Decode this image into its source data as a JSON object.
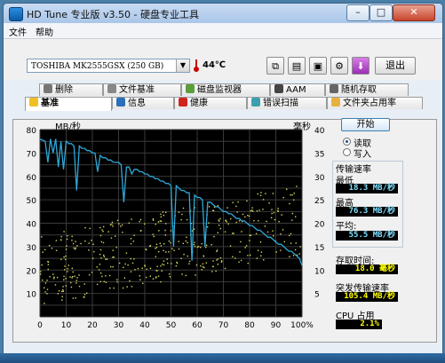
{
  "window": {
    "title": "HD Tune 专业版 v3.50 - 硬盘专业工具",
    "controls": {
      "minimize": "–",
      "maximize": "□",
      "close": "✕"
    }
  },
  "menu": {
    "items": [
      "文件",
      "帮助"
    ]
  },
  "toolbar": {
    "drive": "TOSHIBA MK2555GSX (250 GB)",
    "temperature": "44℃",
    "exit_label": "退出",
    "icons": [
      "copy-info-icon",
      "copy-screen-icon",
      "save-icon",
      "options-icon",
      "download-icon"
    ]
  },
  "tabs": {
    "row1": [
      "删除",
      "文件基准",
      "磁盘监视器",
      "AAM",
      "随机存取"
    ],
    "row2": [
      "基准",
      "信息",
      "健康",
      "错误扫描",
      "文件夹占用率"
    ],
    "active": "基准"
  },
  "benchmark": {
    "start_label": "开始",
    "mode_options": [
      "读取",
      "写入"
    ],
    "selected_mode": "读取",
    "transfer_rate_label": "传输速率",
    "min_label": "最低",
    "min_value": "18.3 MB/秒",
    "max_label": "最高",
    "max_value": "76.3 MB/秒",
    "avg_label": "平均:",
    "avg_value": "55.5 MB/秒",
    "access_time_label": "存取时间:",
    "access_time_value": "18.0 毫秒",
    "burst_label": "突发传输速率",
    "burst_value": "105.4 MB/秒",
    "cpu_label": "CPU 占用",
    "cpu_value": "2.1%"
  },
  "chart_data": {
    "type": "line",
    "y_left_unit": "MB/秒",
    "y_right_unit": "毫秒",
    "y_left_ticks": [
      "80",
      "70",
      "60",
      "50",
      "40",
      "30",
      "20",
      "10"
    ],
    "y_right_ticks": [
      "40",
      "35",
      "30",
      "25",
      "20",
      "15",
      "10",
      "5"
    ],
    "x_ticks": [
      "0",
      "10",
      "20",
      "30",
      "40",
      "50",
      "60",
      "70",
      "80",
      "90",
      "100%"
    ],
    "ylim_left": [
      0,
      80
    ],
    "ylim_right": [
      0,
      40
    ],
    "xlim": [
      0,
      100
    ],
    "grid": true,
    "series": [
      {
        "color": "#2ea8d8",
        "x": [
          0,
          2,
          3,
          4,
          5,
          6,
          7,
          8,
          9,
          10,
          11,
          12,
          13,
          14,
          15,
          16,
          17,
          18,
          19,
          20,
          21,
          22,
          23,
          24,
          25,
          26,
          27,
          28,
          29,
          30,
          31,
          32,
          33,
          34,
          35,
          36,
          37,
          38,
          39,
          40,
          41,
          42,
          43,
          44,
          45,
          46,
          47,
          48,
          49,
          50,
          51,
          52,
          53,
          54,
          55,
          56,
          57,
          58,
          59,
          60,
          61,
          62,
          63,
          64,
          65,
          66,
          67,
          68,
          69,
          70,
          71,
          72,
          73,
          74,
          75,
          76,
          77,
          78,
          79,
          80,
          81,
          82,
          83,
          84,
          85,
          86,
          87,
          88,
          89,
          90,
          91,
          92,
          93,
          94,
          95,
          96,
          97,
          98,
          99,
          100
        ],
        "y": [
          76,
          75,
          66,
          76,
          70,
          76,
          64,
          75,
          63,
          75,
          74,
          74,
          73,
          54,
          73,
          72,
          72,
          71,
          71,
          70,
          70,
          62,
          69,
          68,
          68,
          67,
          67,
          66,
          66,
          66,
          65,
          49,
          64,
          64,
          61,
          63,
          63,
          62,
          62,
          61,
          61,
          60,
          60,
          59,
          59,
          58,
          58,
          57,
          57,
          56,
          30,
          56,
          55,
          54,
          54,
          53,
          53,
          24,
          52,
          51,
          51,
          50,
          30,
          49,
          49,
          48,
          47,
          47,
          46,
          45,
          45,
          44,
          44,
          43,
          42,
          42,
          41,
          41,
          40,
          39,
          39,
          38,
          37,
          37,
          36,
          35,
          34,
          34,
          33,
          32,
          31,
          31,
          30,
          29,
          28,
          28,
          27,
          26,
          25,
          22
        ]
      }
    ]
  }
}
